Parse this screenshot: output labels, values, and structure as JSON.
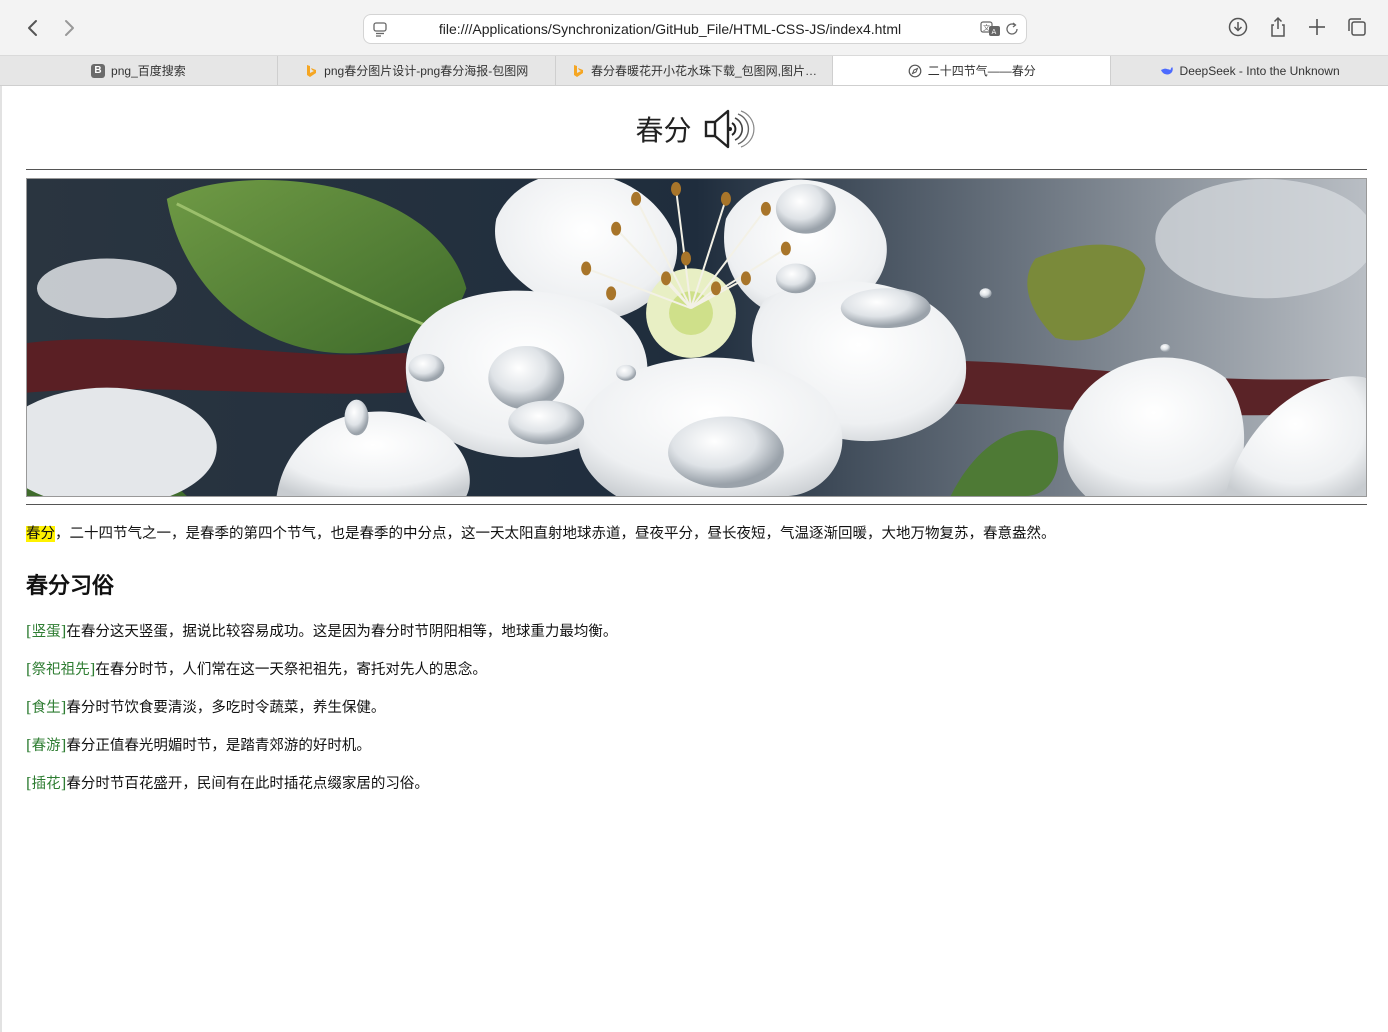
{
  "browser": {
    "url": "file:///Applications/Synchronization/GitHub_File/HTML-CSS-JS/index4.html",
    "tabs": [
      {
        "label": "png_百度搜索",
        "favicon": "b-icon",
        "active": false
      },
      {
        "label": "png春分图片设计-png春分海报-包图网",
        "favicon": "bing-icon",
        "active": false
      },
      {
        "label": "春分春暖花开小花水珠下载_包图网,图片…",
        "favicon": "bing-icon",
        "active": false
      },
      {
        "label": "二十四节气——春分",
        "favicon": "compass-icon",
        "active": true
      },
      {
        "label": "DeepSeek - Into the Unknown",
        "favicon": "deepseek-icon",
        "active": false
      }
    ],
    "favicon_letter_b": "B"
  },
  "page": {
    "title": "春分",
    "intro": {
      "highlight": "春分",
      "text": "，二十四节气之一，是春季的第四个节气，也是春季的中分点，这一天太阳直射地球赤道，昼夜平分，昼长夜短，气温逐渐回暖，大地万物复苏，春意盎然。"
    },
    "customs_heading": "春分习俗",
    "customs": [
      {
        "tag": "[竖蛋]",
        "text": "在春分这天竖蛋，据说比较容易成功。这是因为春分时节阴阳相等，地球重力最均衡。"
      },
      {
        "tag": "[祭祀祖先]",
        "text": "在春分时节，人们常在这一天祭祀祖先，寄托对先人的思念。"
      },
      {
        "tag": "[食生]",
        "text": "春分时节饮食要清淡，多吃时令蔬菜，养生保健。"
      },
      {
        "tag": "[春游]",
        "text": "春分正值春光明媚时节，是踏青郊游的好时机。"
      },
      {
        "tag": "[插花]",
        "text": "春分时节百花盛开，民间有在此时插花点缀家居的习俗。"
      }
    ]
  },
  "colors": {
    "highlight": "#fff200",
    "tag_green": "#2e7d32",
    "chrome_bg": "#f3f3f3",
    "tab_bg": "#e6e6e6"
  }
}
